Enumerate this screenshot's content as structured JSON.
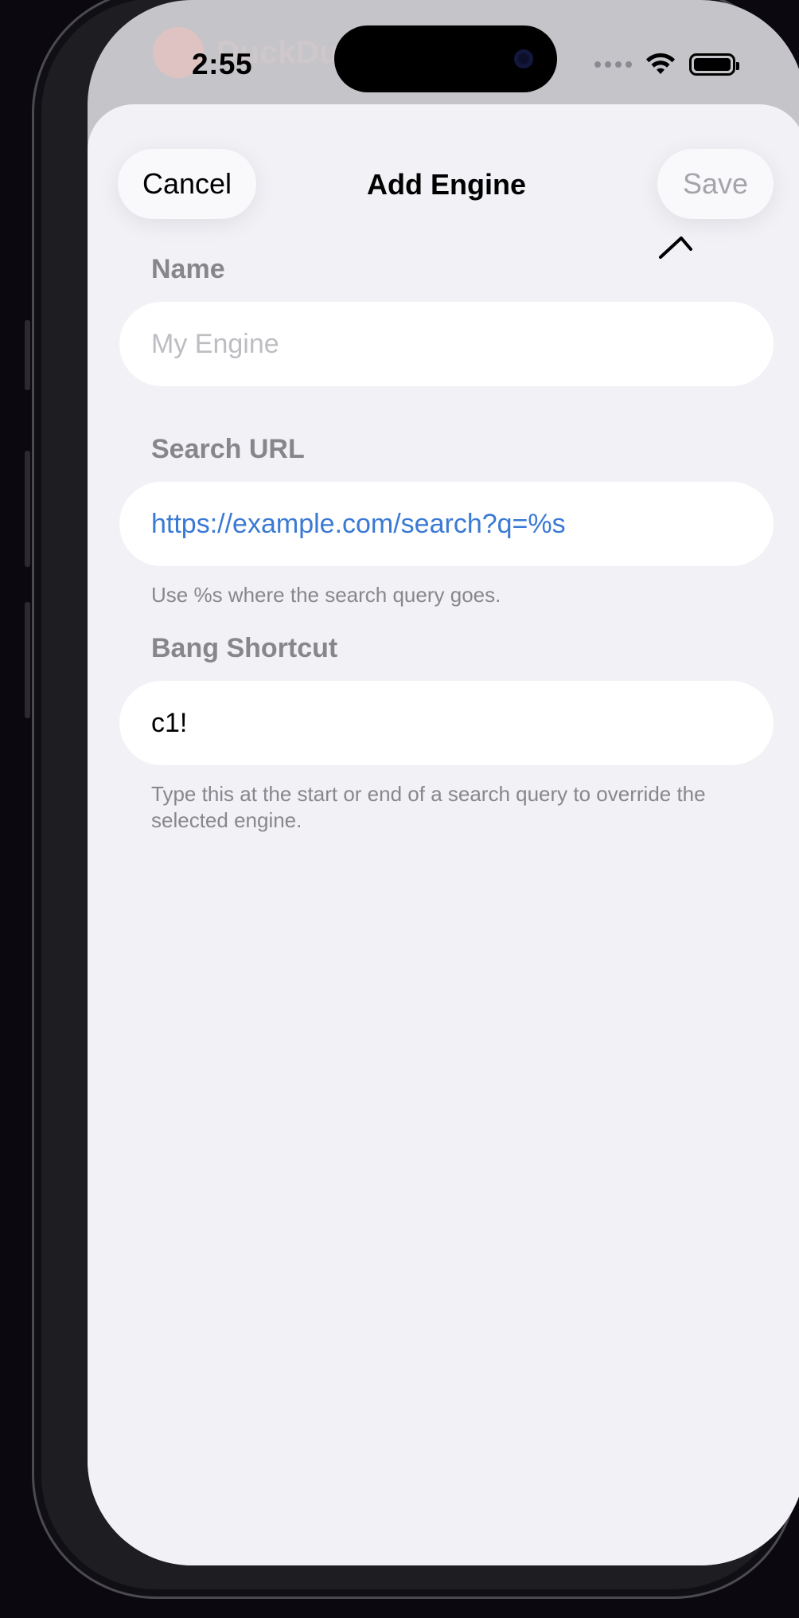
{
  "status_bar": {
    "time": "2:55"
  },
  "background_app": {
    "brand": "DuckDuck"
  },
  "sheet": {
    "title": "Add Engine",
    "cancel_label": "Cancel",
    "save_label": "Save"
  },
  "form": {
    "name": {
      "label": "Name",
      "placeholder": "My Engine",
      "value": ""
    },
    "search_url": {
      "label": "Search URL",
      "value": "https://example.com/search?q=%s",
      "help": "Use %s where the search query goes."
    },
    "bang_shortcut": {
      "label": "Bang Shortcut",
      "value": "c1!",
      "help": "Type this at the start or end of a search query to override the selected engine."
    }
  },
  "colors": {
    "accent_link": "#3a79d4",
    "sheet_background": "#f1f1f6",
    "disabled_text": "#a4a4aa"
  }
}
